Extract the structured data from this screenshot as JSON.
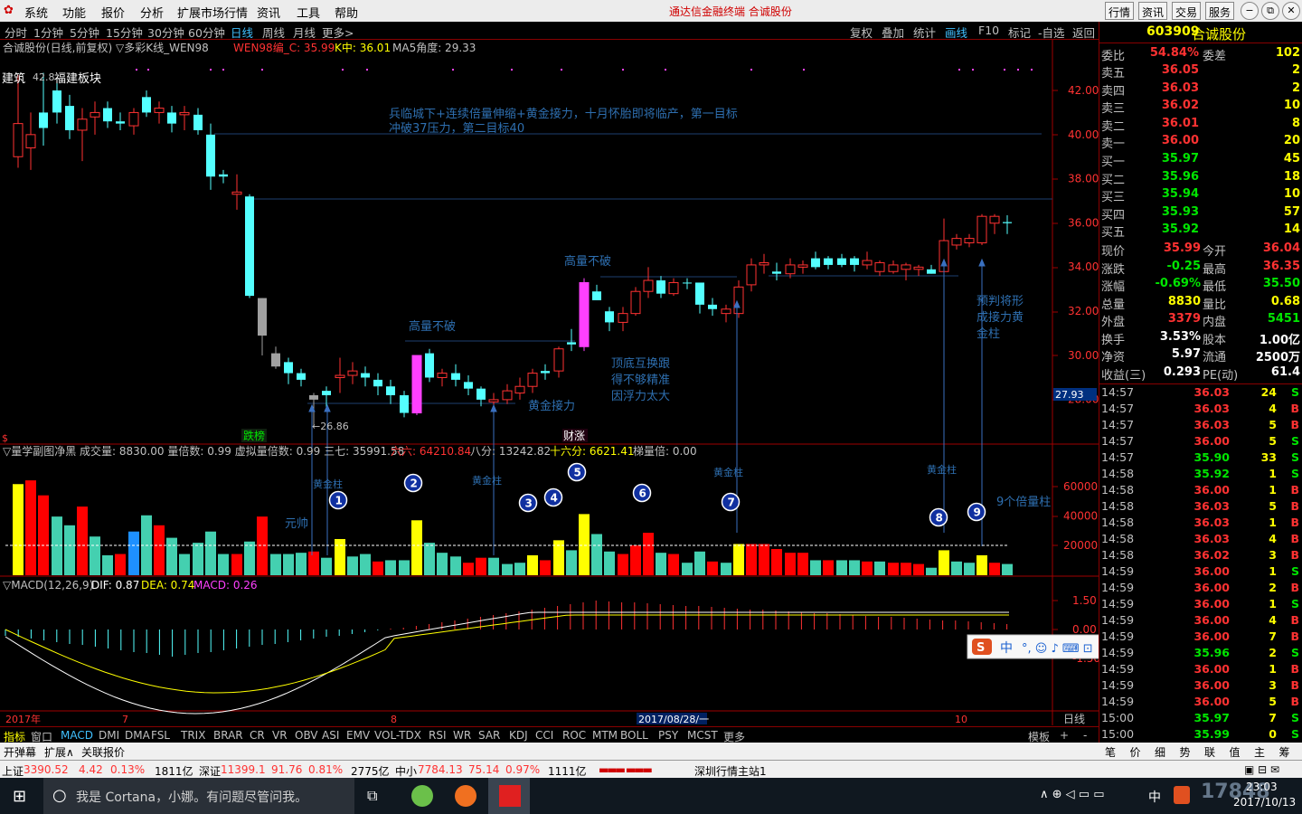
{
  "menu": {
    "items": [
      "系统",
      "功能",
      "报价",
      "分析",
      "扩展市场行情",
      "资讯",
      "工具",
      "帮助"
    ],
    "title": "通达信金融终端  合诚股份",
    "right_buttons": [
      "行情",
      "资讯",
      "交易",
      "服务"
    ]
  },
  "periods": {
    "items": [
      "分时",
      "1分钟",
      "5分钟",
      "15分钟",
      "30分钟",
      "60分钟",
      "日线",
      "周线",
      "月线",
      "更多>"
    ],
    "active": 6
  },
  "tools": {
    "items": [
      "复权",
      "叠加",
      "统计",
      "画线",
      "F10",
      "标记",
      "-自选",
      "返回"
    ],
    "active": 3
  },
  "chart": {
    "header": "合诚股份(日线,前复权) ▽多彩K线_WEN98",
    "wen98": "WEN98编_C: 35.99",
    "kzhong": "K中: 36.01",
    "ma5": "MA5角度: 29.33",
    "sector_left": "建筑",
    "sector_right": "福建板块",
    "high_mark": "42.8",
    "low_mark": "←26.86",
    "annot_main_1": "兵临城下+连续倍量伸缩+黄金接力，十月怀胎即将临产，第一目标",
    "annot_main_2": "冲破37压力，第二目标40",
    "annot_gaoliang_1": "高量不破",
    "annot_gaoliang_2": "高量不破",
    "annot_huangjin": "黄金接力",
    "annot_dingdi_1": "顶底互换跟",
    "annot_dingdi_2": "得不够精准",
    "annot_dingdi_3": "因浮力太大",
    "annot_yupan_1": "预判将形",
    "annot_yupan_2": "成接力黄",
    "annot_yupan_3": "金柱",
    "tag_dieban": "跌榜",
    "tag_caizhang": "财涨",
    "price_axis": [
      "42.00",
      "40.00",
      "38.00",
      "36.00",
      "34.00",
      "32.00",
      "30.00",
      "28.00"
    ],
    "current_price_tag": "27.93",
    "vol_header": "▽量学副图净黑  成交量: 8830.00  量倍数: 0.99  虚拟量倍数: 0.99  三七: 35991.58",
    "vol_header_liuliu": "六六: 64210.84",
    "vol_header_bafen": "八分: 13242.82",
    "vol_header_shiliu": "十六分: 6621.41",
    "vol_header_tiliang": "梯量倍: 0.00",
    "vol_axis": [
      "60000",
      "40000",
      "20000"
    ],
    "vol_annot_yuanshuai": "元帅",
    "vol_annot_hj1": "黄金柱",
    "vol_annot_hj2": "黄金柱",
    "vol_annot_hj3": "黄金柱",
    "vol_annot_hj4": "黄金柱",
    "vol_annot_9bei": "9个倍量柱",
    "circle_labels": [
      "1",
      "2",
      "3",
      "4",
      "5",
      "6",
      "7",
      "8",
      "9"
    ],
    "macd_header": "▽MACD(12,26,9)",
    "macd_dif": "DIF: 0.87",
    "macd_dea": "DEA: 0.74",
    "macd_val": "MACD: 0.26",
    "macd_axis": [
      "1.50",
      "0.00",
      "-1.50"
    ],
    "date_axis": [
      "2017年",
      "7",
      "8",
      "2017/08/28/一",
      "10"
    ],
    "date_axis_right": "日线"
  },
  "ime": {
    "label": "中"
  },
  "indicator_tabs": {
    "items": [
      "指标",
      "窗口",
      "MACD",
      "DMI",
      "DMA",
      "FSL",
      "TRIX",
      "BRAR",
      "CR",
      "VR",
      "OBV",
      "ASI",
      "EMV",
      "VOL-TDX",
      "RSI",
      "WR",
      "SAR",
      "KDJ",
      "CCI",
      "ROC",
      "MTM",
      "BOLL",
      "PSY",
      "MCST",
      "更多"
    ],
    "active": 2,
    "right": [
      "模板",
      "+",
      "-"
    ]
  },
  "bottom_tabs": {
    "items": [
      "开弹幕",
      "扩展∧",
      "关联报价"
    ]
  },
  "right_tabs": {
    "items": [
      "笔",
      "价",
      "细",
      "势",
      "联",
      "值",
      "主",
      "筹"
    ]
  },
  "quote": {
    "code": "603909",
    "name": "合诚股份",
    "weibi_label": "委比",
    "weibi": "54.84%",
    "weicha_label": "委差",
    "weicha": "102",
    "asks": [
      {
        "l": "卖五",
        "p": "36.05",
        "q": "2"
      },
      {
        "l": "卖四",
        "p": "36.03",
        "q": "2"
      },
      {
        "l": "卖三",
        "p": "36.02",
        "q": "10"
      },
      {
        "l": "卖二",
        "p": "36.01",
        "q": "8"
      },
      {
        "l": "卖一",
        "p": "36.00",
        "q": "20"
      }
    ],
    "bids": [
      {
        "l": "买一",
        "p": "35.97",
        "q": "45"
      },
      {
        "l": "买二",
        "p": "35.96",
        "q": "18"
      },
      {
        "l": "买三",
        "p": "35.94",
        "q": "10"
      },
      {
        "l": "买四",
        "p": "35.93",
        "q": "57"
      },
      {
        "l": "买五",
        "p": "35.92",
        "q": "14"
      }
    ],
    "stats": [
      {
        "l1": "现价",
        "v1": "35.99",
        "c1": "red",
        "l2": "今开",
        "v2": "36.04",
        "c2": "red"
      },
      {
        "l1": "涨跌",
        "v1": "-0.25",
        "c1": "grn",
        "l2": "最高",
        "v2": "36.35",
        "c2": "red"
      },
      {
        "l1": "涨幅",
        "v1": "-0.69%",
        "c1": "grn",
        "l2": "最低",
        "v2": "35.50",
        "c2": "grn"
      },
      {
        "l1": "总量",
        "v1": "8830",
        "c1": "yel",
        "l2": "量比",
        "v2": "0.68",
        "c2": "yel"
      },
      {
        "l1": "外盘",
        "v1": "3379",
        "c1": "red",
        "l2": "内盘",
        "v2": "5451",
        "c2": "grn"
      },
      {
        "l1": "换手",
        "v1": "3.53%",
        "c1": "wht",
        "l2": "股本",
        "v2": "1.00亿",
        "c2": "wht"
      },
      {
        "l1": "净资",
        "v1": "5.97",
        "c1": "wht",
        "l2": "流通",
        "v2": "2500万",
        "c2": "wht"
      },
      {
        "l1": "收益(三)",
        "v1": "0.293",
        "c1": "wht",
        "l2": "PE(动)",
        "v2": "61.4",
        "c2": "wht"
      }
    ],
    "ticks": [
      {
        "t": "14:57",
        "p": "36.03",
        "v": "24",
        "f": "S"
      },
      {
        "t": "14:57",
        "p": "36.03",
        "v": "4",
        "f": "B"
      },
      {
        "t": "14:57",
        "p": "36.03",
        "v": "5",
        "f": "B"
      },
      {
        "t": "14:57",
        "p": "36.00",
        "v": "5",
        "f": "S"
      },
      {
        "t": "14:57",
        "p": "35.90",
        "v": "33",
        "f": "S"
      },
      {
        "t": "14:58",
        "p": "35.92",
        "v": "1",
        "f": "S"
      },
      {
        "t": "14:58",
        "p": "36.00",
        "v": "1",
        "f": "B"
      },
      {
        "t": "14:58",
        "p": "36.03",
        "v": "5",
        "f": "B"
      },
      {
        "t": "14:58",
        "p": "36.03",
        "v": "1",
        "f": "B"
      },
      {
        "t": "14:58",
        "p": "36.03",
        "v": "4",
        "f": "B"
      },
      {
        "t": "14:58",
        "p": "36.02",
        "v": "3",
        "f": "B"
      },
      {
        "t": "14:59",
        "p": "36.00",
        "v": "1",
        "f": "S"
      },
      {
        "t": "14:59",
        "p": "36.00",
        "v": "2",
        "f": "B"
      },
      {
        "t": "14:59",
        "p": "36.00",
        "v": "1",
        "f": "S"
      },
      {
        "t": "14:59",
        "p": "36.00",
        "v": "4",
        "f": "B"
      },
      {
        "t": "14:59",
        "p": "36.00",
        "v": "7",
        "f": "B"
      },
      {
        "t": "14:59",
        "p": "35.96",
        "v": "2",
        "f": "S"
      },
      {
        "t": "14:59",
        "p": "36.00",
        "v": "1",
        "f": "B"
      },
      {
        "t": "14:59",
        "p": "36.00",
        "v": "3",
        "f": "B"
      },
      {
        "t": "14:59",
        "p": "36.00",
        "v": "5",
        "f": "B"
      },
      {
        "t": "15:00",
        "p": "35.97",
        "v": "7",
        "f": "S"
      },
      {
        "t": "15:00",
        "p": "35.99",
        "v": "0",
        "f": "S"
      }
    ]
  },
  "status": {
    "sh_label": "上证",
    "sh_val": "3390.52",
    "sh_chg": "4.42",
    "sh_pct": "0.13%",
    "sh_amt": "1811亿",
    "sz_label": "深证",
    "sz_val": "11399.1",
    "sz_chg": "91.76",
    "sz_pct": "0.81%",
    "sz_amt": "2775亿",
    "zx_label": "中小",
    "zx_val": "7784.13",
    "zx_chg": "75.14",
    "zx_pct": "0.97%",
    "zx_amt": "1111亿",
    "server": "深圳行情主站1"
  },
  "taskbar": {
    "search": "我是 Cortana，小娜。有问题尽管问我。",
    "ime": "中",
    "time": "23:03",
    "date": "2017/10/13",
    "watermark": "17848"
  }
}
